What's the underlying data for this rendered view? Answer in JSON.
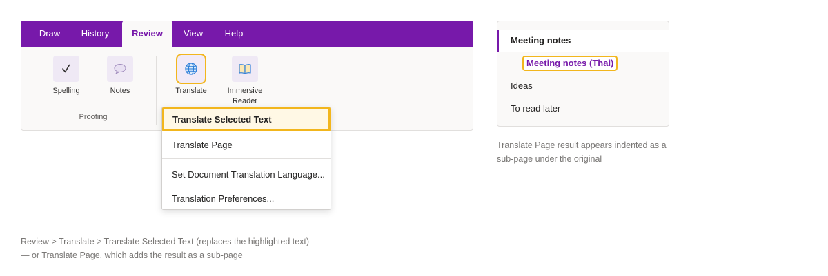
{
  "ribbon": {
    "tabs": [
      {
        "label": "Draw",
        "active": false
      },
      {
        "label": "History",
        "active": false
      },
      {
        "label": "Review",
        "active": true
      },
      {
        "label": "View",
        "active": false
      },
      {
        "label": "Help",
        "active": false
      }
    ],
    "commands": [
      {
        "label": "Spelling",
        "icon": "spelling-check-icon"
      },
      {
        "label": "Notes",
        "icon": "speech-bubble-icon"
      },
      {
        "label": "Translate",
        "icon": "globe-icon"
      },
      {
        "label_line1": "Immersive",
        "label_line2": "Reader",
        "icon": "book-icon"
      }
    ],
    "groups": [
      {
        "label": "Proofing"
      }
    ]
  },
  "translate_menu": {
    "items": [
      {
        "label": "Translate Selected Text"
      },
      {
        "label": "Translate Page"
      },
      {
        "label": "Set Document Translation Language..."
      },
      {
        "label": "Translation Preferences..."
      }
    ]
  },
  "notes_panel": {
    "pages": [
      {
        "label": "Meeting notes"
      },
      {
        "label": "Meeting notes (Thai)"
      },
      {
        "label": "Ideas"
      },
      {
        "label": "To read later"
      }
    ]
  },
  "captions": {
    "panel_line1": "Translate Page result appears indented as a",
    "panel_line2": "sub-page under the original",
    "path_line1": "Review > Translate > Translate Selected Text (replaces the highlighted text)",
    "path_line2": "— or Translate Page, which adds the result as a sub-page"
  },
  "colors": {
    "accent_purple": "#7719aa",
    "highlight_yellow": "#f2b61d",
    "highlight_fill": "#fff8e5"
  }
}
